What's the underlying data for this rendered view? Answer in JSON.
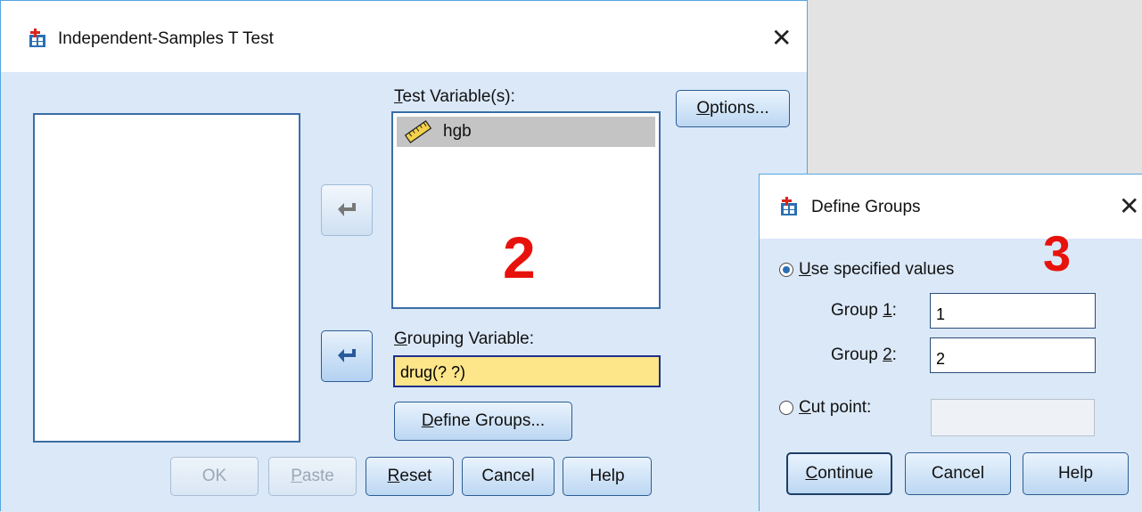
{
  "main_dialog": {
    "title": "Independent-Samples T Test",
    "close_glyph": "✕",
    "test_variables_label": {
      "key": "T",
      "rest": "est Variable(s):"
    },
    "test_variables": [
      {
        "name": "hgb",
        "icon": "ruler-scale-icon"
      }
    ],
    "grouping_variable_label": {
      "key": "G",
      "rest": "rouping Variable:"
    },
    "grouping_variable_value": "drug(? ?)",
    "define_groups_button": {
      "key": "D",
      "rest": "efine Groups..."
    },
    "options_button": {
      "key": "O",
      "rest": "ptions..."
    },
    "footer_buttons": {
      "ok": "OK",
      "paste": {
        "key": "P",
        "rest": "aste"
      },
      "reset": {
        "key": "R",
        "rest": "eset"
      },
      "cancel": "Cancel",
      "help": "Help"
    },
    "annotation_number": "2"
  },
  "define_groups_dialog": {
    "title": "Define Groups",
    "close_glyph": "✕",
    "use_specified_values": {
      "key": "U",
      "rest": "se specified values",
      "selected": true
    },
    "group1": {
      "label_pre": "Group ",
      "key": "1",
      "label_post": ":",
      "value": "1"
    },
    "group2": {
      "label_pre": "Group ",
      "key": "2",
      "label_post": ":",
      "value": "2"
    },
    "cut_point": {
      "key": "C",
      "rest": "ut point:",
      "selected": false,
      "value": ""
    },
    "buttons": {
      "continue": {
        "key": "C",
        "rest": "ontinue"
      },
      "cancel": "Cancel",
      "help": "Help"
    },
    "annotation_number": "3"
  },
  "colors": {
    "annotation": "#e8120c",
    "dialog_body": "#dbe8f8",
    "grouping_field": "#fde58a",
    "selected_item": "#c4c4c4",
    "accent_border": "#55a6e0"
  }
}
